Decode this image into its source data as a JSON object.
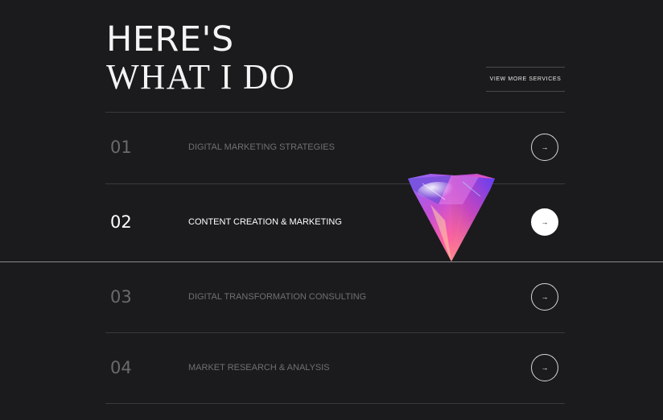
{
  "heading": {
    "line1": "HERE'S",
    "line2": "WHAT I DO"
  },
  "view_more_label": "VIEW MORE SERVICES",
  "services": [
    {
      "number": "01",
      "label": "DIGITAL MARKETING STRATEGIES",
      "active": false
    },
    {
      "number": "02",
      "label": "CONTENT CREATION & MARKETING",
      "active": true
    },
    {
      "number": "03",
      "label": "DIGITAL TRANSFORMATION CONSULTING",
      "active": false
    },
    {
      "number": "04",
      "label": "MARKET RESEARCH & ANALYSIS",
      "active": false
    }
  ],
  "arrow_icon": "→",
  "colors": {
    "background": "#1b1b1d",
    "text_active": "#ffffff",
    "text_inactive": "#707072",
    "divider": "#3a3a3c"
  }
}
